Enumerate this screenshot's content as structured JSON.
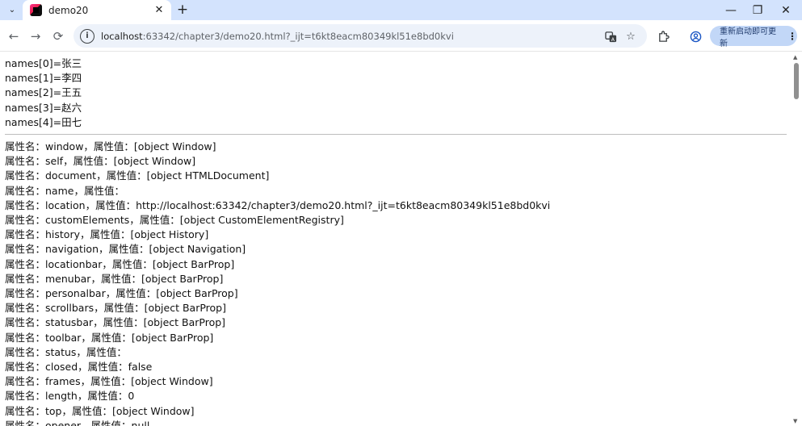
{
  "browser": {
    "tab": {
      "title": "demo20",
      "close": "✕"
    },
    "new_tab": "+",
    "window": {
      "minimize": "—",
      "restore": "❐",
      "close": "✕"
    },
    "nav": {
      "back": "←",
      "forward": "→",
      "reload": "⟳"
    },
    "address": {
      "host": "localhost",
      "path": ":63342/chapter3/demo20.html?_ijt=t6kt8eacm80349kl51e8bd0kvi"
    },
    "update_button": "重新启动即可更新",
    "icons": [
      "tab-search-icon",
      "favicon-icon",
      "translate-icon",
      "bookmark-star-icon",
      "extensions-icon",
      "profile-icon",
      "menu-dots-icon"
    ]
  },
  "page": {
    "names": [
      "names[0]=张三",
      "names[1]=李四",
      "names[2]=王五",
      "names[3]=赵六",
      "names[4]=田七"
    ],
    "properties": [
      "属性名：window，属性值：[object Window]",
      "属性名：self，属性值：[object Window]",
      "属性名：document，属性值：[object HTMLDocument]",
      "属性名：name，属性值：",
      "属性名：location，属性值：http://localhost:63342/chapter3/demo20.html?_ijt=t6kt8eacm80349kl51e8bd0kvi",
      "属性名：customElements，属性值：[object CustomElementRegistry]",
      "属性名：history，属性值：[object History]",
      "属性名：navigation，属性值：[object Navigation]",
      "属性名：locationbar，属性值：[object BarProp]",
      "属性名：menubar，属性值：[object BarProp]",
      "属性名：personalbar，属性值：[object BarProp]",
      "属性名：scrollbars，属性值：[object BarProp]",
      "属性名：statusbar，属性值：[object BarProp]",
      "属性名：toolbar，属性值：[object BarProp]",
      "属性名：status，属性值：",
      "属性名：closed，属性值：false",
      "属性名：frames，属性值：[object Window]",
      "属性名：length，属性值：0",
      "属性名：top，属性值：[object Window]",
      "属性名：opener，属性值：null"
    ]
  }
}
